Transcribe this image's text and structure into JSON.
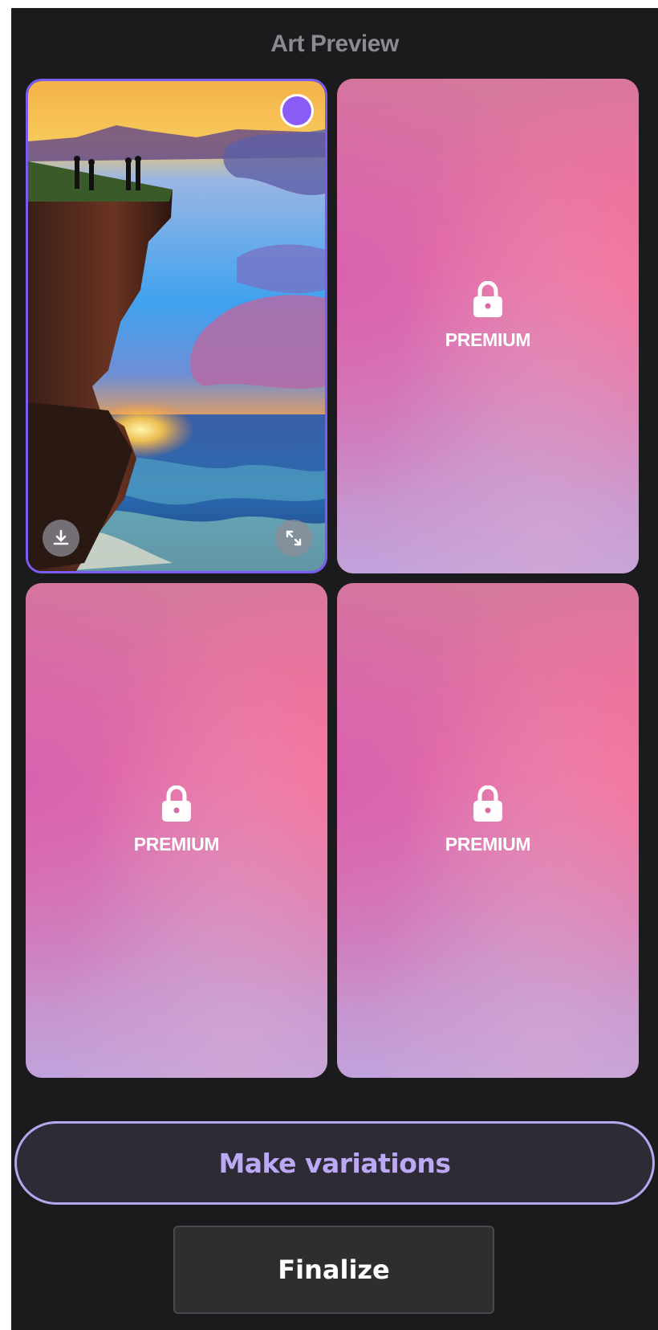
{
  "header": {
    "title": "Art Preview"
  },
  "cards": [
    {
      "kind": "image",
      "selected": true,
      "icons": [
        "select-indicator",
        "download-icon",
        "expand-icon"
      ]
    },
    {
      "kind": "locked",
      "label": "PREMIUM",
      "icon": "lock-icon"
    },
    {
      "kind": "locked",
      "label": "PREMIUM",
      "icon": "lock-icon"
    },
    {
      "kind": "locked",
      "label": "PREMIUM",
      "icon": "lock-icon"
    }
  ],
  "actions": {
    "make_variations_label": "Make variations",
    "finalize_label": "Finalize"
  },
  "colors": {
    "background": "#1b1b1d",
    "accent": "#8a5cf6",
    "accent_text": "#bca8f5",
    "title_text": "#8a8a8f"
  }
}
